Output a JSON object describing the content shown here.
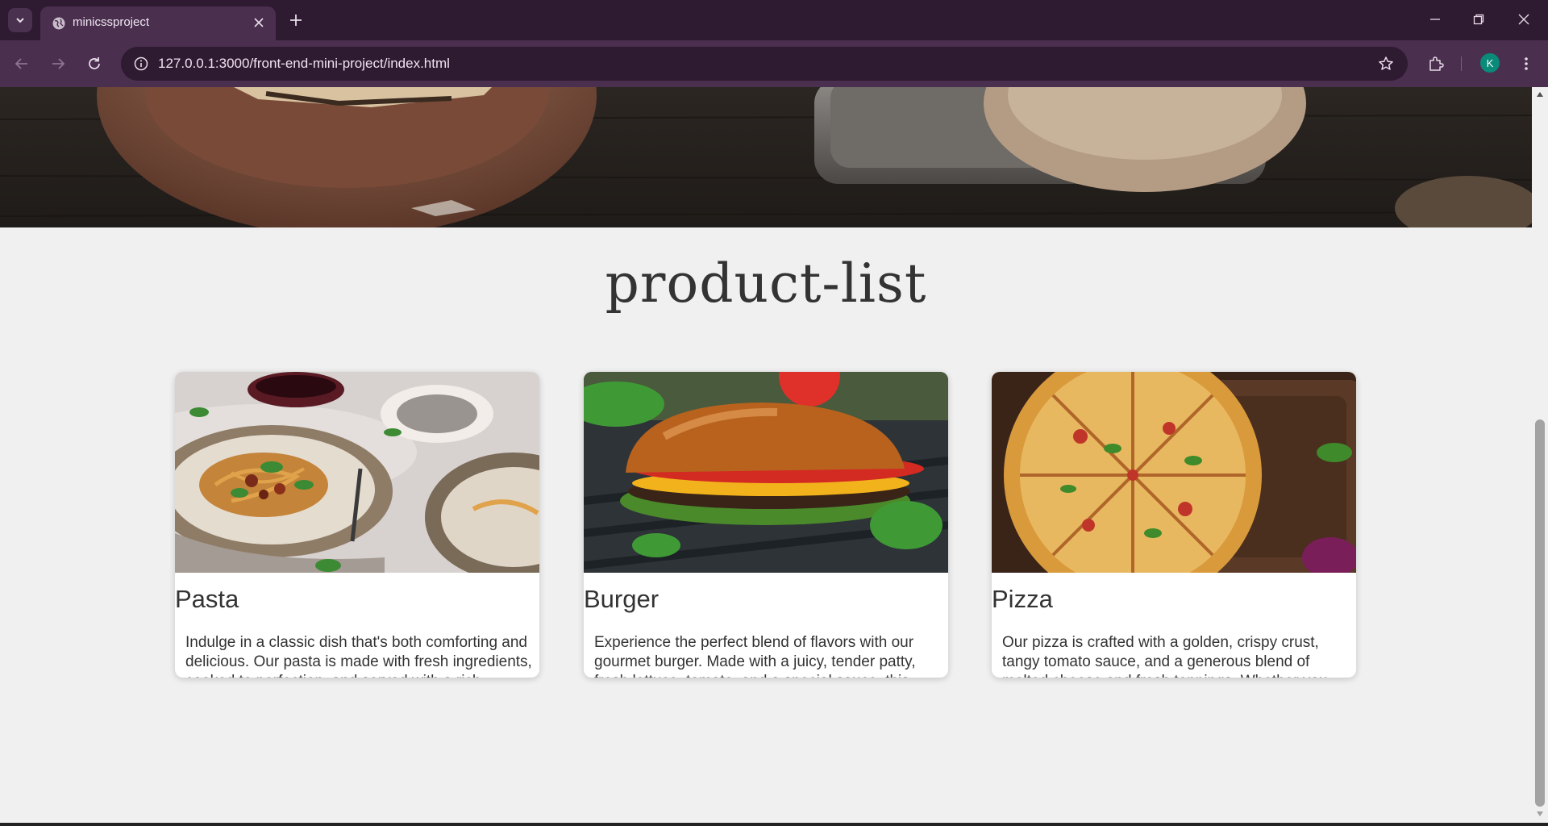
{
  "browser": {
    "tab_title": "minicssproject",
    "url": "127.0.0.1:3000/front-end-mini-project/index.html",
    "profile_initial": "K",
    "accent": "#4a2f4f"
  },
  "page": {
    "heading": "product-list",
    "products": [
      {
        "name": "Pasta",
        "description": "Indulge in a classic dish that's both comforting and delicious. Our pasta is made with fresh ingredients, cooked to perfection, and served with a rich, savory sauce that will leave you craving more. Perfect for a cozy night in or a special meal with loved ones."
      },
      {
        "name": "Burger",
        "description": "Experience the perfect blend of flavors with our gourmet burger. Made with a juicy, tender patty, fresh lettuce, tomato, and a special sauce, this burger is sure to satisfy your cravings for something hearty and flavorful. Bite into this masterpiece and taste the difference!"
      },
      {
        "name": "Pizza",
        "description": "Our pizza is crafted with a golden, crispy crust, tangy tomato sauce, and a generous blend of melted cheese and fresh toppings. Whether you like it loaded with vegetables, pepperoni, or just plain cheese, each bite is a delightful combination of taste and texture."
      }
    ]
  }
}
